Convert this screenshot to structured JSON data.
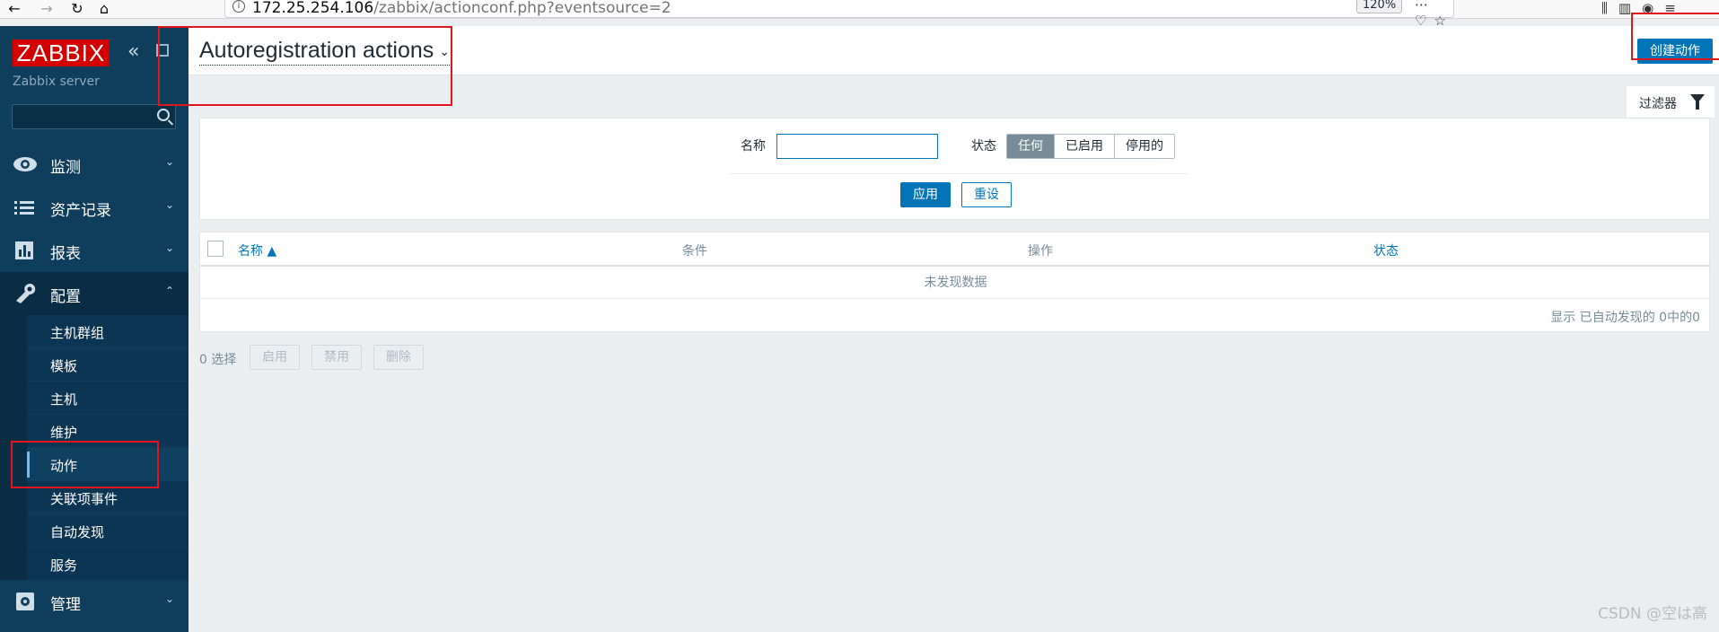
{
  "browser": {
    "url_host": "172.25.254.106",
    "url_path": "/zabbix/actionconf.php?eventsource=2",
    "zoom": "120%",
    "icons": [
      "back-icon",
      "forward-icon",
      "reload-icon",
      "home-icon",
      "info-icon",
      "more-icon",
      "pocket-icon",
      "bookmark-star-icon",
      "library-icon",
      "sidebar-icon",
      "account-icon",
      "hamburger-menu-icon"
    ]
  },
  "sidebar": {
    "logo": "ZABBIX",
    "server_name": "Zabbix server",
    "search_placeholder": "",
    "menu": [
      {
        "label": "监测",
        "icon": "eye-icon"
      },
      {
        "label": "资产记录",
        "icon": "list-icon"
      },
      {
        "label": "报表",
        "icon": "bar-chart-icon"
      },
      {
        "label": "配置",
        "icon": "wrench-icon"
      },
      {
        "label": "管理",
        "icon": "gear-icon"
      }
    ],
    "submenu": [
      "主机群组",
      "模板",
      "主机",
      "维护",
      "动作",
      "关联项事件",
      "自动发现",
      "服务"
    ],
    "submenu_selected": "动作"
  },
  "header": {
    "title": "Autoregistration actions",
    "create_button": "创建动作"
  },
  "filter": {
    "tab_label": "过滤器",
    "name_label": "名称",
    "name_value": "",
    "status_label": "状态",
    "status_options": [
      "任何",
      "已启用",
      "停用的"
    ],
    "status_selected": "任何",
    "apply": "应用",
    "reset": "重设"
  },
  "table": {
    "columns": [
      "名称 ▲",
      "条件",
      "操作",
      "状态"
    ],
    "empty_message": "未发现数据",
    "footer": "显示 已自动发现的 0中的0"
  },
  "actions": {
    "selected_count": "0 选择",
    "enable": "启用",
    "disable": "禁用",
    "delete": "删除"
  },
  "watermark": "CSDN @空は高",
  "colors": {
    "sidebar_bg": "#0f3e5c",
    "primary": "#0275b8",
    "logo_red": "#d40000",
    "annotation_red": "#e0151d"
  }
}
